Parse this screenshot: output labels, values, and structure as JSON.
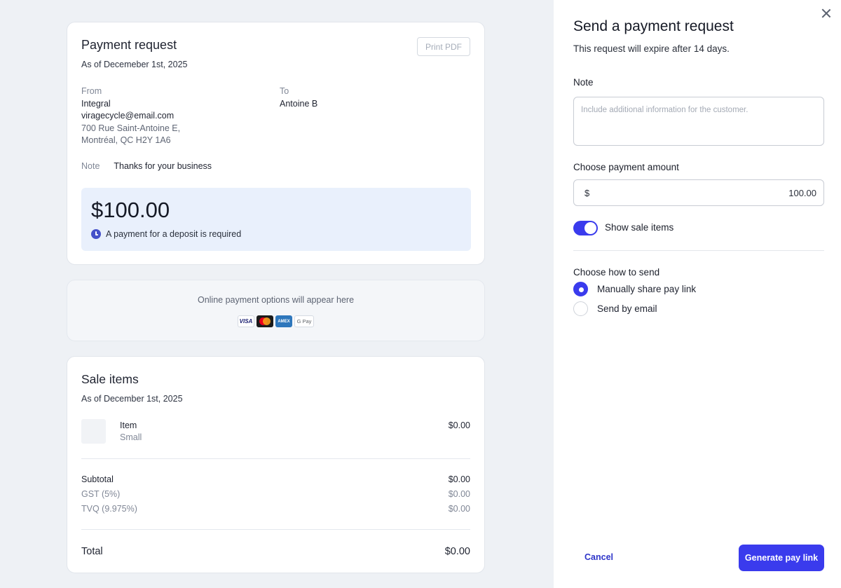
{
  "request_card": {
    "title": "Payment request",
    "date": "As of Decemeber 1st, 2025",
    "print_label": "Print PDF",
    "from": {
      "label": "From",
      "name": "Integral",
      "email": "viragecycle@email.com",
      "address_line1": "700 Rue Saint-Antoine E,",
      "address_line2": "Montréal, QC  H2Y 1A6"
    },
    "to": {
      "label": "To",
      "name": "Antoine B"
    },
    "note_label": "Note",
    "note_value": "Thanks for your business",
    "amount": "$100.00",
    "deposit_text": "A payment for a deposit is required"
  },
  "payment_options": {
    "text": "Online payment options will appear here",
    "logos": [
      "VISA",
      "mastercard",
      "AMEX",
      "G Pay"
    ]
  },
  "sale_items": {
    "title": "Sale items",
    "date": "As of December 1st, 2025",
    "items": [
      {
        "name": "Item",
        "variant": "Small",
        "price": "$0.00"
      }
    ],
    "subtotal_label": "Subtotal",
    "subtotal_value": "$0.00",
    "gst_label": "GST (5%)",
    "gst_value": "$0.00",
    "tvq_label": "TVQ (9.975%)",
    "tvq_value": "$0.00",
    "total_label": "Total",
    "total_value": "$0.00"
  },
  "panel": {
    "title": "Send a payment request",
    "subtitle": "This request will expire after 14 days.",
    "note_label": "Note",
    "note_placeholder": "Include additional information for the customer.",
    "amount_label": "Choose payment amount",
    "currency_symbol": "$",
    "amount_value": "100.00",
    "toggle_label": "Show sale items",
    "toggle_on": true,
    "send_label": "Choose how to send",
    "send_options": [
      {
        "label": "Manually share pay link",
        "selected": true
      },
      {
        "label": "Send by email",
        "selected": false
      }
    ],
    "cancel_label": "Cancel",
    "generate_label": "Generate pay link"
  },
  "colors": {
    "accent": "#3a3bed",
    "amount_box_bg": "#e9f0fc",
    "page_bg": "#eef1f5"
  }
}
